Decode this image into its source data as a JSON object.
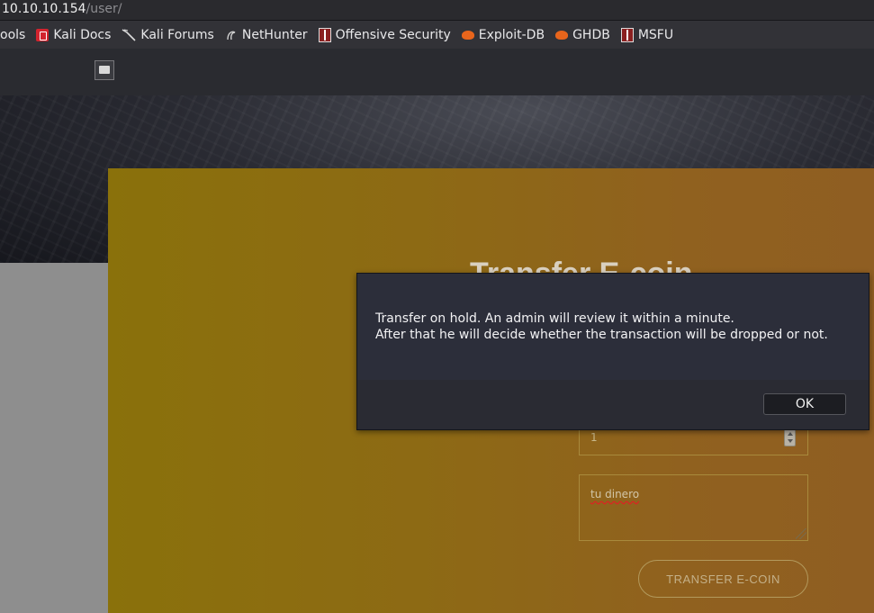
{
  "browser": {
    "url_host": "10.10.10.154",
    "url_path": "/user/"
  },
  "bookmarks": [
    {
      "label": "ools",
      "icon": "tools-icon"
    },
    {
      "label": "Kali Docs",
      "icon": "kali-docs-icon"
    },
    {
      "label": "Kali Forums",
      "icon": "kali-dragon-icon"
    },
    {
      "label": "NetHunter",
      "icon": "nethunter-icon"
    },
    {
      "label": "Offensive Security",
      "icon": "offsec-icon"
    },
    {
      "label": "Exploit-DB",
      "icon": "exploit-db-icon"
    },
    {
      "label": "GHDB",
      "icon": "exploit-db-icon"
    },
    {
      "label": "MSFU",
      "icon": "offsec-icon"
    }
  ],
  "page": {
    "title": "Transfer E-coin",
    "amount_value": "1",
    "message_value": "tu dinero",
    "transfer_label": "TRANSFER E-COIN"
  },
  "dialog": {
    "line1": "Transfer on hold. An admin will review it within a minute.",
    "line2": "After that he will decide whether the transaction will be dropped or not.",
    "ok_label": "OK"
  },
  "colors": {
    "panel_gradient_start": "#8a710b",
    "panel_gradient_end": "#8f5e22",
    "dialog_bg": "#2c2e3a",
    "left_panel": "#8e8e8e"
  }
}
